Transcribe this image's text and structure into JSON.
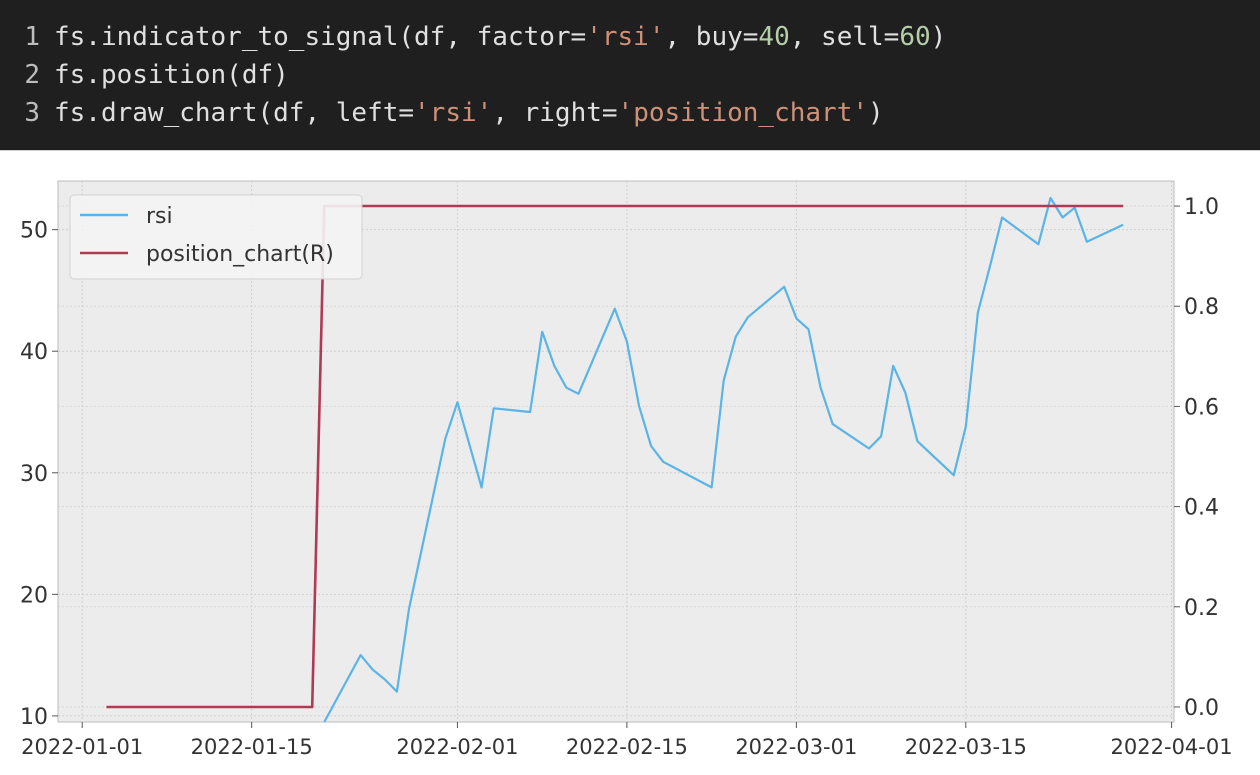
{
  "code": {
    "lines": [
      {
        "number": "1",
        "parts": [
          {
            "t": "fs.indicator_to_signal(df, factor=",
            "c": "plain"
          },
          {
            "t": "'rsi'",
            "c": "str"
          },
          {
            "t": ", buy=",
            "c": "plain"
          },
          {
            "t": "40",
            "c": "num"
          },
          {
            "t": ", sell=",
            "c": "plain"
          },
          {
            "t": "60",
            "c": "num"
          },
          {
            "t": ")",
            "c": "plain"
          }
        ]
      },
      {
        "number": "2",
        "parts": [
          {
            "t": "fs.position(df)",
            "c": "plain"
          }
        ]
      },
      {
        "number": "3",
        "parts": [
          {
            "t": "fs.draw_chart(df, left=",
            "c": "plain"
          },
          {
            "t": "'rsi'",
            "c": "str"
          },
          {
            "t": ", right=",
            "c": "plain"
          },
          {
            "t": "'position_chart'",
            "c": "str"
          },
          {
            "t": ")",
            "c": "plain"
          }
        ]
      }
    ]
  },
  "chart_data": {
    "type": "line",
    "title": "",
    "xlabel": "",
    "ylabel_left": "",
    "ylabel_right": "",
    "x_ticks": [
      "2022-01-01",
      "2022-01-15",
      "2022-02-01",
      "2022-02-15",
      "2022-03-01",
      "2022-03-15",
      "2022-04-01"
    ],
    "ylim_left": [
      9.5,
      54
    ],
    "yticks_left": [
      10,
      20,
      30,
      40,
      50
    ],
    "ylim_right": [
      -0.03,
      1.05
    ],
    "yticks_right": [
      "0.0",
      "0.2",
      "0.4",
      "0.6",
      "0.8",
      "1.0"
    ],
    "grid": true,
    "legend": "top-left",
    "series": [
      {
        "name": "rsi",
        "axis": "left",
        "color": "#5ab4e8",
        "x": [
          "2022-01-21",
          "2022-01-24",
          "2022-01-25",
          "2022-01-26",
          "2022-01-27",
          "2022-01-28",
          "2022-01-31",
          "2022-02-01",
          "2022-02-03",
          "2022-02-04",
          "2022-02-07",
          "2022-02-08",
          "2022-02-09",
          "2022-02-10",
          "2022-02-11",
          "2022-02-14",
          "2022-02-15",
          "2022-02-16",
          "2022-02-17",
          "2022-02-18",
          "2022-02-22",
          "2022-02-23",
          "2022-02-24",
          "2022-02-25",
          "2022-02-28",
          "2022-03-01",
          "2022-03-02",
          "2022-03-03",
          "2022-03-04",
          "2022-03-07",
          "2022-03-08",
          "2022-03-09",
          "2022-03-10",
          "2022-03-11",
          "2022-03-14",
          "2022-03-15",
          "2022-03-16",
          "2022-03-17",
          "2022-03-18",
          "2022-03-21",
          "2022-03-22",
          "2022-03-23",
          "2022-03-24",
          "2022-03-25",
          "2022-03-28"
        ],
        "values": [
          9.5,
          15.0,
          13.8,
          13.0,
          12.0,
          18.8,
          32.8,
          35.8,
          28.8,
          35.3,
          35.0,
          41.6,
          38.8,
          37.0,
          36.5,
          43.5,
          40.8,
          35.5,
          32.2,
          30.9,
          28.8,
          37.6,
          41.2,
          42.8,
          45.3,
          42.7,
          41.8,
          37.0,
          34.0,
          32.0,
          33.0,
          38.8,
          36.6,
          32.6,
          29.8,
          33.8,
          43.2,
          47.0,
          51.0,
          48.8,
          52.6,
          51.0,
          51.8,
          49.0,
          50.4
        ]
      },
      {
        "name": "position_chart(R)",
        "axis": "right",
        "color": "#b03a55",
        "x": [
          "2022-01-03",
          "2022-01-20",
          "2022-01-21",
          "2022-03-28"
        ],
        "values": [
          0,
          0,
          1,
          1
        ]
      }
    ]
  }
}
